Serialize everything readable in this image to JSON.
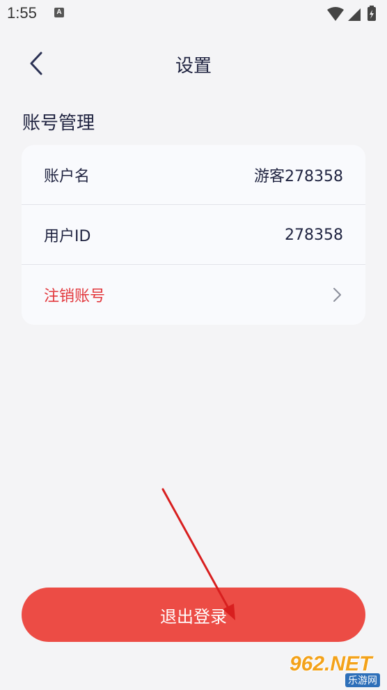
{
  "status_bar": {
    "time": "1:55",
    "notification_badge": "A",
    "icons": [
      "wifi-icon",
      "signal-icon",
      "battery-icon"
    ]
  },
  "header": {
    "title": "设置",
    "back_icon": "chevron-left-icon"
  },
  "section": {
    "title": "账号管理"
  },
  "account": {
    "rows": [
      {
        "label": "账户名",
        "value": "游客278358"
      },
      {
        "label": "用户ID",
        "value": "278358"
      },
      {
        "label": "注销账号",
        "icon": "chevron-right-icon"
      }
    ]
  },
  "logout": {
    "label": "退出登录"
  },
  "watermark": {
    "main": "962.NET",
    "sub": "乐游网"
  },
  "colors": {
    "background": "#f4f4f6",
    "card": "#f9fafd",
    "text": "#1f2340",
    "danger": "#e2363b",
    "logout_button": "#ec4c45",
    "annotation_arrow": "#d81f1f"
  }
}
